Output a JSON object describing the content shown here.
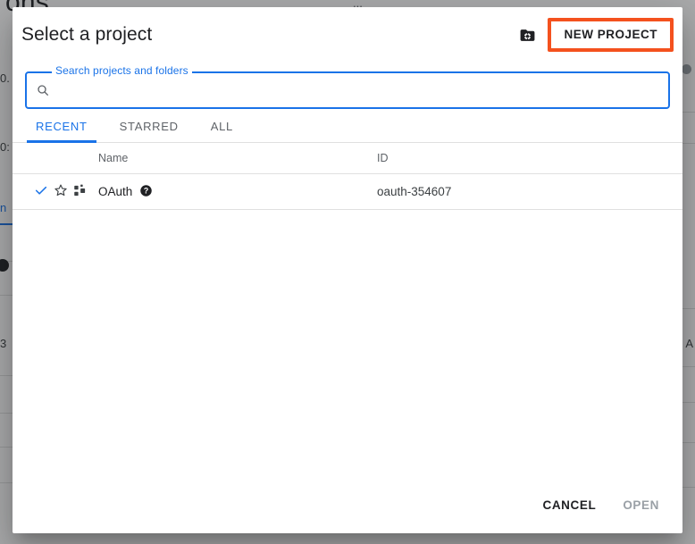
{
  "dialog": {
    "title": "Select a project",
    "manage_icon": "folder-gear-icon",
    "new_project_label": "NEW PROJECT",
    "highlight_color": "#f4511e",
    "accent_color": "#1a73e8"
  },
  "search": {
    "label": "Search projects and folders",
    "value": "",
    "placeholder": "",
    "icon": "search-icon"
  },
  "tabs": [
    {
      "label": "RECENT",
      "active": true
    },
    {
      "label": "STARRED",
      "active": false
    },
    {
      "label": "ALL",
      "active": false
    }
  ],
  "table": {
    "columns": [
      "",
      "Name",
      "ID"
    ],
    "rows": [
      {
        "selected": true,
        "starred": false,
        "type_icon": "project-nodes-icon",
        "name": "OAuth",
        "help_icon": "help-circle-icon",
        "id": "oauth-354607"
      }
    ]
  },
  "footer": {
    "cancel_label": "CANCEL",
    "open_label": "OPEN",
    "open_disabled": true
  },
  "background": {
    "title_fragment": "ons",
    "top_fragment_1": "...",
    "left_fragments": [
      "0.",
      "0:",
      "n",
      "3"
    ],
    "right_fragments": [
      "d A"
    ]
  }
}
